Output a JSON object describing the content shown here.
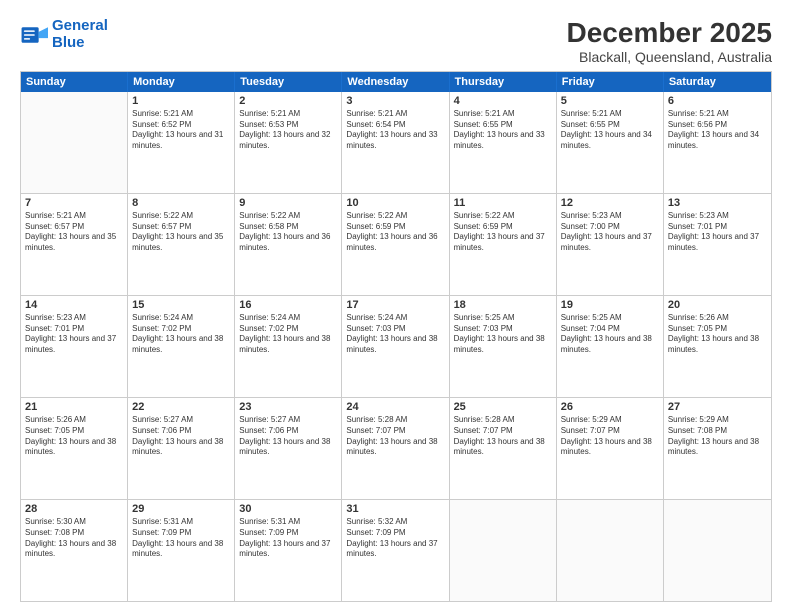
{
  "logo": {
    "line1": "General",
    "line2": "Blue"
  },
  "title": "December 2025",
  "subtitle": "Blackall, Queensland, Australia",
  "header": {
    "days": [
      "Sunday",
      "Monday",
      "Tuesday",
      "Wednesday",
      "Thursday",
      "Friday",
      "Saturday"
    ]
  },
  "weeks": [
    [
      {
        "day": "",
        "empty": true
      },
      {
        "day": "1",
        "sunrise": "5:21 AM",
        "sunset": "6:52 PM",
        "daylight": "13 hours and 31 minutes."
      },
      {
        "day": "2",
        "sunrise": "5:21 AM",
        "sunset": "6:53 PM",
        "daylight": "13 hours and 32 minutes."
      },
      {
        "day": "3",
        "sunrise": "5:21 AM",
        "sunset": "6:54 PM",
        "daylight": "13 hours and 33 minutes."
      },
      {
        "day": "4",
        "sunrise": "5:21 AM",
        "sunset": "6:55 PM",
        "daylight": "13 hours and 33 minutes."
      },
      {
        "day": "5",
        "sunrise": "5:21 AM",
        "sunset": "6:55 PM",
        "daylight": "13 hours and 34 minutes."
      },
      {
        "day": "6",
        "sunrise": "5:21 AM",
        "sunset": "6:56 PM",
        "daylight": "13 hours and 34 minutes."
      }
    ],
    [
      {
        "day": "7",
        "sunrise": "5:21 AM",
        "sunset": "6:57 PM",
        "daylight": "13 hours and 35 minutes."
      },
      {
        "day": "8",
        "sunrise": "5:22 AM",
        "sunset": "6:57 PM",
        "daylight": "13 hours and 35 minutes."
      },
      {
        "day": "9",
        "sunrise": "5:22 AM",
        "sunset": "6:58 PM",
        "daylight": "13 hours and 36 minutes."
      },
      {
        "day": "10",
        "sunrise": "5:22 AM",
        "sunset": "6:59 PM",
        "daylight": "13 hours and 36 minutes."
      },
      {
        "day": "11",
        "sunrise": "5:22 AM",
        "sunset": "6:59 PM",
        "daylight": "13 hours and 37 minutes."
      },
      {
        "day": "12",
        "sunrise": "5:23 AM",
        "sunset": "7:00 PM",
        "daylight": "13 hours and 37 minutes."
      },
      {
        "day": "13",
        "sunrise": "5:23 AM",
        "sunset": "7:01 PM",
        "daylight": "13 hours and 37 minutes."
      }
    ],
    [
      {
        "day": "14",
        "sunrise": "5:23 AM",
        "sunset": "7:01 PM",
        "daylight": "13 hours and 37 minutes."
      },
      {
        "day": "15",
        "sunrise": "5:24 AM",
        "sunset": "7:02 PM",
        "daylight": "13 hours and 38 minutes."
      },
      {
        "day": "16",
        "sunrise": "5:24 AM",
        "sunset": "7:02 PM",
        "daylight": "13 hours and 38 minutes."
      },
      {
        "day": "17",
        "sunrise": "5:24 AM",
        "sunset": "7:03 PM",
        "daylight": "13 hours and 38 minutes."
      },
      {
        "day": "18",
        "sunrise": "5:25 AM",
        "sunset": "7:03 PM",
        "daylight": "13 hours and 38 minutes."
      },
      {
        "day": "19",
        "sunrise": "5:25 AM",
        "sunset": "7:04 PM",
        "daylight": "13 hours and 38 minutes."
      },
      {
        "day": "20",
        "sunrise": "5:26 AM",
        "sunset": "7:05 PM",
        "daylight": "13 hours and 38 minutes."
      }
    ],
    [
      {
        "day": "21",
        "sunrise": "5:26 AM",
        "sunset": "7:05 PM",
        "daylight": "13 hours and 38 minutes."
      },
      {
        "day": "22",
        "sunrise": "5:27 AM",
        "sunset": "7:06 PM",
        "daylight": "13 hours and 38 minutes."
      },
      {
        "day": "23",
        "sunrise": "5:27 AM",
        "sunset": "7:06 PM",
        "daylight": "13 hours and 38 minutes."
      },
      {
        "day": "24",
        "sunrise": "5:28 AM",
        "sunset": "7:07 PM",
        "daylight": "13 hours and 38 minutes."
      },
      {
        "day": "25",
        "sunrise": "5:28 AM",
        "sunset": "7:07 PM",
        "daylight": "13 hours and 38 minutes."
      },
      {
        "day": "26",
        "sunrise": "5:29 AM",
        "sunset": "7:07 PM",
        "daylight": "13 hours and 38 minutes."
      },
      {
        "day": "27",
        "sunrise": "5:29 AM",
        "sunset": "7:08 PM",
        "daylight": "13 hours and 38 minutes."
      }
    ],
    [
      {
        "day": "28",
        "sunrise": "5:30 AM",
        "sunset": "7:08 PM",
        "daylight": "13 hours and 38 minutes."
      },
      {
        "day": "29",
        "sunrise": "5:31 AM",
        "sunset": "7:09 PM",
        "daylight": "13 hours and 38 minutes."
      },
      {
        "day": "30",
        "sunrise": "5:31 AM",
        "sunset": "7:09 PM",
        "daylight": "13 hours and 37 minutes."
      },
      {
        "day": "31",
        "sunrise": "5:32 AM",
        "sunset": "7:09 PM",
        "daylight": "13 hours and 37 minutes."
      },
      {
        "day": "",
        "empty": true
      },
      {
        "day": "",
        "empty": true
      },
      {
        "day": "",
        "empty": true
      }
    ]
  ]
}
